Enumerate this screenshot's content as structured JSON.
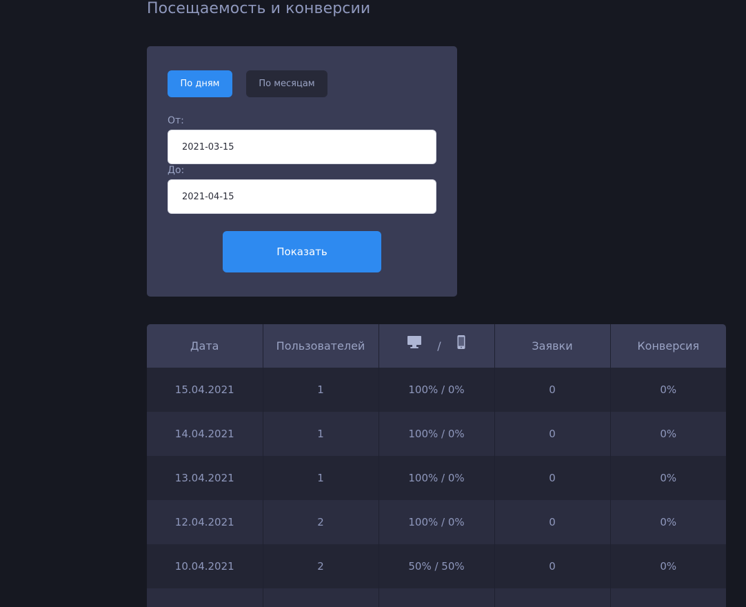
{
  "page": {
    "title": "Посещаемость и конверсии"
  },
  "filter": {
    "mode_days_label": "По дням",
    "mode_months_label": "По месяцам",
    "from_label": "От:",
    "from_value": "2021-03-15",
    "to_label": "До:",
    "to_value": "2021-04-15",
    "show_button_label": "Показать"
  },
  "table": {
    "headers": {
      "date": "Дата",
      "users": "Пользователей",
      "device_separator": "/",
      "requests": "Заявки",
      "conversion": "Конверсия"
    },
    "device_icons": [
      "desktop-icon",
      "mobile-icon"
    ],
    "rows": [
      {
        "date": "15.04.2021",
        "users": "1",
        "devices": "100% / 0%",
        "requests": "0",
        "conversion": "0%"
      },
      {
        "date": "14.04.2021",
        "users": "1",
        "devices": "100% / 0%",
        "requests": "0",
        "conversion": "0%"
      },
      {
        "date": "13.04.2021",
        "users": "1",
        "devices": "100% / 0%",
        "requests": "0",
        "conversion": "0%"
      },
      {
        "date": "12.04.2021",
        "users": "2",
        "devices": "100% / 0%",
        "requests": "0",
        "conversion": "0%"
      },
      {
        "date": "10.04.2021",
        "users": "2",
        "devices": "50% / 50%",
        "requests": "0",
        "conversion": "0%"
      },
      {
        "date": "",
        "users": "",
        "devices": "",
        "requests": "",
        "conversion": ""
      }
    ]
  },
  "colors": {
    "background": "#161821",
    "card": "#393c55",
    "accent": "#2e8af0",
    "text": "#9aa3c4"
  }
}
